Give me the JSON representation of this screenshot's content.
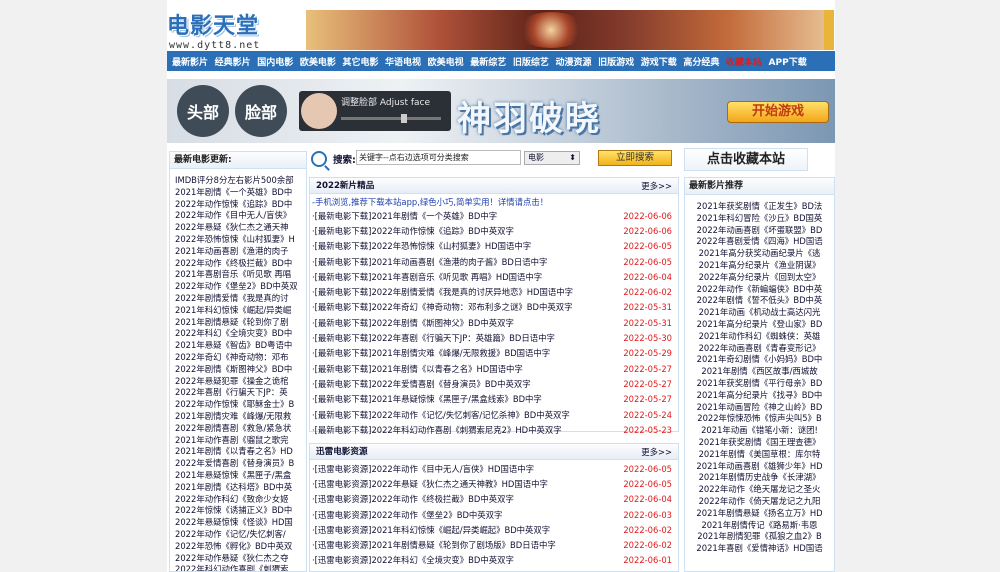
{
  "logo": {
    "main": "电影天堂",
    "sub": "www.dytt8.net"
  },
  "nav": [
    "最新影片",
    "经典影片",
    "国内电影",
    "欧美电影",
    "其它电影",
    "华语电视",
    "欧美电视",
    "最新综艺",
    "旧版综艺",
    "动漫资源",
    "旧版游戏",
    "游戏下载",
    "高分经典",
    "收藏本站",
    "APP下载"
  ],
  "banner": {
    "face_left": "头部",
    "face_right": "脸部",
    "adjust": "调整脸部 Adjust face",
    "title": "神羽破晓",
    "button": "开始游戏"
  },
  "left": {
    "title": "最新电影更新:",
    "items": [
      "IMDB评分8分左右影片500余部",
      "2021年剧情《一个英雄》BD中",
      "2022年动作惊悚《追踪》BD中",
      "2022年动作《目中无人/盲侠》",
      "2022年悬疑《狄仁杰之通天神",
      "2022年恐怖惊悚《山村狐妻》H",
      "2021年动画喜剧《渔港的肉子",
      "2022年动作《终极拦截》BD中",
      "2021年喜剧音乐《听见歌 再唱",
      "2022年动作《堡垒2》BD中英双",
      "2022年剧情爱情《我是真的讨",
      "2021年科幻惊悚《崛起/异类崛",
      "2021年剧情悬疑《轮到你了剧",
      "2022年科幻《全境灾变》BD中",
      "2021年悬疑《智齿》BD粤语中",
      "2022年奇幻《神奇动物：邓布",
      "2022年剧情《斯图神父》BD中",
      "2022年悬疑犯罪《操金之诡棺",
      "2022年喜剧《行骗天下JP：英",
      "2022年动作惊悚《耶稣金士》B",
      "2021年剧情灾难《峰爆/无限救",
      "2022年剧情喜剧《救急/紧急状",
      "2021年动作喜剧《骝鼠之歌完",
      "2021年剧情《以青春之名》HD",
      "2022年爱情喜剧《替身演员》B",
      "2021年悬疑惊悚《黑匣子/黑盒",
      "2021年剧情《达科塔》BD中英",
      "2022年动作科幻《致命少女姬",
      "2022年惊悚《诱捕正义》BD中",
      "2022年悬疑惊悚《怪谈》HD国",
      "2022年动作《记忆/失忆刺客/",
      "2022年恐怖《孵化》BD中英双",
      "2022年动作悬疑《狄仁杰之夺",
      "2022年科幻动作喜剧《刺猬索"
    ]
  },
  "search": {
    "label": "搜索:",
    "placeholder": "关键字--点右边选项可分类搜索",
    "select": "电影",
    "button": "立即搜索"
  },
  "box1": {
    "title": "2022新片精品",
    "more": "更多>>",
    "notice": "-手机浏览,推荐下载本站app,绿色小巧,简单实用！详情请点击！",
    "rows": [
      {
        "title": "·[最新电影下载]2021年剧情《一个英雄》BD中字",
        "date": "2022-06-06"
      },
      {
        "title": "·[最新电影下载]2022年动作惊悚《追踪》BD中英双字",
        "date": "2022-06-06"
      },
      {
        "title": "·[最新电影下载]2022年恐怖惊悚《山村狐妻》HD国语中字",
        "date": "2022-06-05"
      },
      {
        "title": "·[最新电影下载]2021年动画喜剧《渔港的肉子酱》BD日语中字",
        "date": "2022-06-05"
      },
      {
        "title": "·[最新电影下载]2021年喜剧音乐《听见歌 再唱》HD国语中字",
        "date": "2022-06-04"
      },
      {
        "title": "·[最新电影下载]2022年剧情爱情《我是真的讨厌异地恋》HD国语中字",
        "date": "2022-06-02"
      },
      {
        "title": "·[最新电影下载]2022年奇幻《神奇动物：邓布利多之谜》BD中英双字",
        "date": "2022-05-31"
      },
      {
        "title": "·[最新电影下载]2022年剧情《斯图神父》BD中英双字",
        "date": "2022-05-31"
      },
      {
        "title": "·[最新电影下载]2022年喜剧《行骗天下JP：英雄篇》BD日语中字",
        "date": "2022-05-30"
      },
      {
        "title": "·[最新电影下载]2021年剧情灾难《峰爆/无限救援》BD国语中字",
        "date": "2022-05-29"
      },
      {
        "title": "·[最新电影下载]2021年剧情《以青春之名》HD国语中字",
        "date": "2022-05-27"
      },
      {
        "title": "·[最新电影下载]2022年爱情喜剧《替身演员》BD中英双字",
        "date": "2022-05-27"
      },
      {
        "title": "·[最新电影下载]2021年悬疑惊悚《黑匣子/黑盒线索》BD中字",
        "date": "2022-05-27"
      },
      {
        "title": "·[最新电影下载]2022年动作《记忆/失忆刺客/记忆杀神》BD中英双字",
        "date": "2022-05-24"
      },
      {
        "title": "·[最新电影下载]2022年科幻动作喜剧《刺猬索尼克2》HD中英双字",
        "date": "2022-05-23"
      }
    ]
  },
  "box2": {
    "title": "迅雷电影资源",
    "more": "更多>>",
    "rows": [
      {
        "title": "·[迅雷电影资源]2022年动作《目中无人/盲侠》HD国语中字",
        "date": "2022-06-05"
      },
      {
        "title": "·[迅雷电影资源]2022年悬疑《狄仁杰之通天神教》HD国语中字",
        "date": "2022-06-05"
      },
      {
        "title": "·[迅雷电影资源]2022年动作《终极拦截》BD中英双字",
        "date": "2022-06-04"
      },
      {
        "title": "·[迅雷电影资源]2022年动作《堡垒2》BD中英双字",
        "date": "2022-06-03"
      },
      {
        "title": "·[迅雷电影资源]2021年科幻惊悚《崛起/异类崛起》BD中英双字",
        "date": "2022-06-02"
      },
      {
        "title": "·[迅雷电影资源]2021年剧情悬疑《轮到你了剧场版》BD日语中字",
        "date": "2022-06-02"
      },
      {
        "title": "·[迅雷电影资源]2022年科幻《全境灾变》BD中英双字",
        "date": "2022-06-01"
      }
    ]
  },
  "right": {
    "fav": "点击收藏本站",
    "title": "最新影片推荐",
    "items": [
      {
        "t": "2021年获奖剧情《正发生》BD法",
        "red": false
      },
      {
        "t": "2021年科幻冒险《沙丘》BD国英",
        "red": false
      },
      {
        "t": "2022年动画喜剧《坏蛋联盟》BD",
        "red": false
      },
      {
        "t": "2022年喜剧爱情《四海》HD国语",
        "red": false
      },
      {
        "t": "2021年高分获奖动画纪录片《逃",
        "red": false
      },
      {
        "t": "2021年高分纪录片《渔业阴谋》",
        "red": false
      },
      {
        "t": "2022年高分纪录片《回到太空》",
        "red": false
      },
      {
        "t": "2022年动作《新蝙蝠侠》BD中英",
        "red": false
      },
      {
        "t": "2022年剧情《誓不低头》BD中英",
        "red": false
      },
      {
        "t": "2021年动画《机动战士高达闪光",
        "red": false
      },
      {
        "t": "2021年高分纪录片《登山家》BD",
        "red": false
      },
      {
        "t": "2021年动作科幻《蜘蛛侠：英雄",
        "red": false
      },
      {
        "t": "2022年动画喜剧《青春变形记》",
        "red": false
      },
      {
        "t": "2021年奇幻剧情《小妈妈》BD中",
        "red": false
      },
      {
        "t": "2021年剧情《西区故事/西城故",
        "red": false
      },
      {
        "t": "2021年获奖剧情《平行母亲》BD",
        "red": false
      },
      {
        "t": "2021年高分纪录片《找寻》BD中",
        "red": false
      },
      {
        "t": "2021年动画冒险《神之山岭》BD",
        "red": false
      },
      {
        "t": "2022年惊悚恐怖《惊声尖叫5》B",
        "red": false
      },
      {
        "t": "2021年动画《错笔小新：谜团!",
        "red": false
      },
      {
        "t": "2021年获奖剧情《国王理查德》",
        "red": false
      },
      {
        "t": "2021年剧情《美国草根：库尔特",
        "red": false
      },
      {
        "t": "2021年动画喜剧《雄狮少年》HD",
        "red": false
      },
      {
        "t": "2021年剧情历史战争《长津湖》",
        "red": false
      },
      {
        "t": "2022年动作《绝天屠龙记之圣火",
        "red": false
      },
      {
        "t": "2022年动作《倚天屠龙记之九阳",
        "red": false
      },
      {
        "t": "2021年剧情悬疑《扬名立万》HD",
        "red": false
      },
      {
        "t": "2021年剧情传记《路易斯·韦恩",
        "red": false
      },
      {
        "t": "2021年剧情犯罪《孤狼之血2》B",
        "red": false
      },
      {
        "t": "2021年喜剧《爱情神话》HD国语",
        "red": false
      }
    ]
  },
  "colors": {
    "nav": "#2b70b6",
    "date": "#e01b1b",
    "border": "#cfe0f0"
  }
}
